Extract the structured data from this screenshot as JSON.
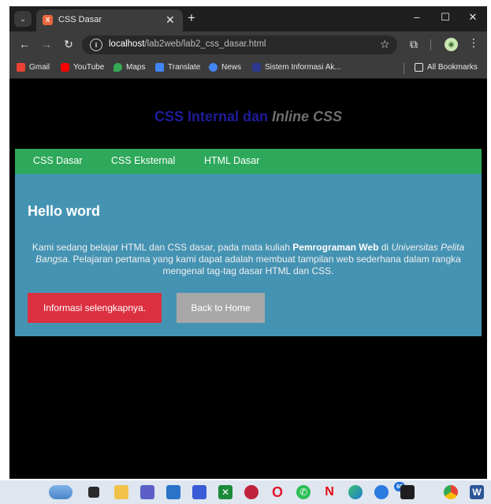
{
  "browser": {
    "tab": {
      "title": "CSS Dasar",
      "favicon": "xampp-icon"
    },
    "window_controls": {
      "minimize": "–",
      "maximize": "☐",
      "close": "✕"
    },
    "toolbar": {
      "url_host": "localhost",
      "url_path": "/lab2web/lab2_css_dasar.html"
    },
    "bookmarks": [
      {
        "label": "Gmail",
        "icon": "gmail-icon",
        "color": "#ea4335"
      },
      {
        "label": "YouTube",
        "icon": "youtube-icon",
        "color": "#ff0000"
      },
      {
        "label": "Maps",
        "icon": "maps-icon",
        "color": "#34a853"
      },
      {
        "label": "Translate",
        "icon": "translate-icon",
        "color": "#4285f4"
      },
      {
        "label": "News",
        "icon": "news-icon",
        "color": "#4285f4"
      },
      {
        "label": "Sistem Informasi Ak...",
        "icon": "university-icon",
        "color": "#2b3a8f"
      }
    ],
    "all_bookmarks": "All Bookmarks"
  },
  "page": {
    "heading_part1": "CSS Internal dan ",
    "heading_part2": "Inline CSS",
    "nav": [
      "CSS Dasar",
      "CSS Eksternal",
      "HTML Dasar"
    ],
    "hero": {
      "title": "Hello word",
      "text_1": "Kami sedang belajar HTML dan CSS dasar, pada mata kuliah ",
      "text_bold": "Pemrograman Web",
      "text_2": " di ",
      "text_italic": "Universitas Pelita Bangsa",
      "text_3": ". Pelajaran pertama yang kami dapat adalah membuat tampilan web sederhana dalam rangka mengenal tag-tag dasar HTML dan CSS.",
      "button_info": "Informasi selengkapnya.",
      "button_home": "Back to Home"
    },
    "colors": {
      "heading_blue": "#1d1d9a",
      "navbar_green": "#2ea85a",
      "hero_blue": "#4593b3",
      "button_red": "#dc3040",
      "button_gray": "#a8a8a8"
    }
  },
  "taskbar": {
    "notification_badge": "68"
  }
}
